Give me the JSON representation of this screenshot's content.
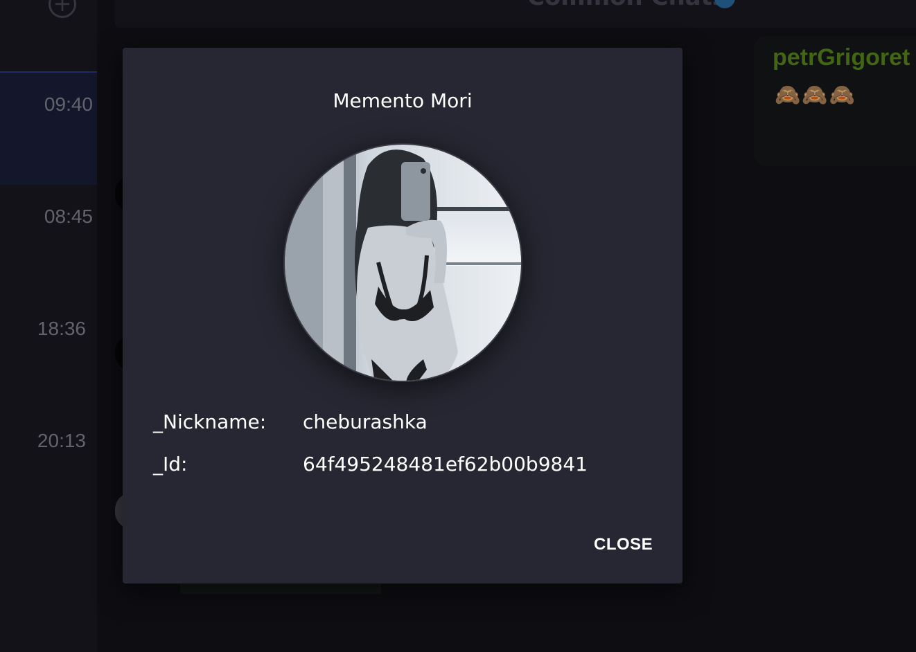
{
  "sidebar": {
    "add_icon": "plus-circle-icon",
    "chats": [
      {
        "time": "09:40",
        "active": true
      },
      {
        "time": "08:45",
        "active": false
      },
      {
        "time": "18:36",
        "active": false
      },
      {
        "time": "20:13",
        "active": false
      }
    ]
  },
  "header": {
    "title": "Common Chats",
    "icon": "gear-icon"
  },
  "message": {
    "author": "petrGrigoret",
    "text": "🙈🙈🙈",
    "author_color": "#5e8e1d"
  },
  "dialog": {
    "title": "Memento Mori",
    "nickname_label": "_Nickname:",
    "nickname_value": "cheburashka",
    "id_label": "_Id:",
    "id_value": "64f495248481ef62b00b9841",
    "close_label": "CLOSE",
    "avatar": "user-avatar-photo"
  },
  "colors": {
    "background": "#131219",
    "dialog_bg": "#272733",
    "active_chat": "#1d1f3c"
  }
}
